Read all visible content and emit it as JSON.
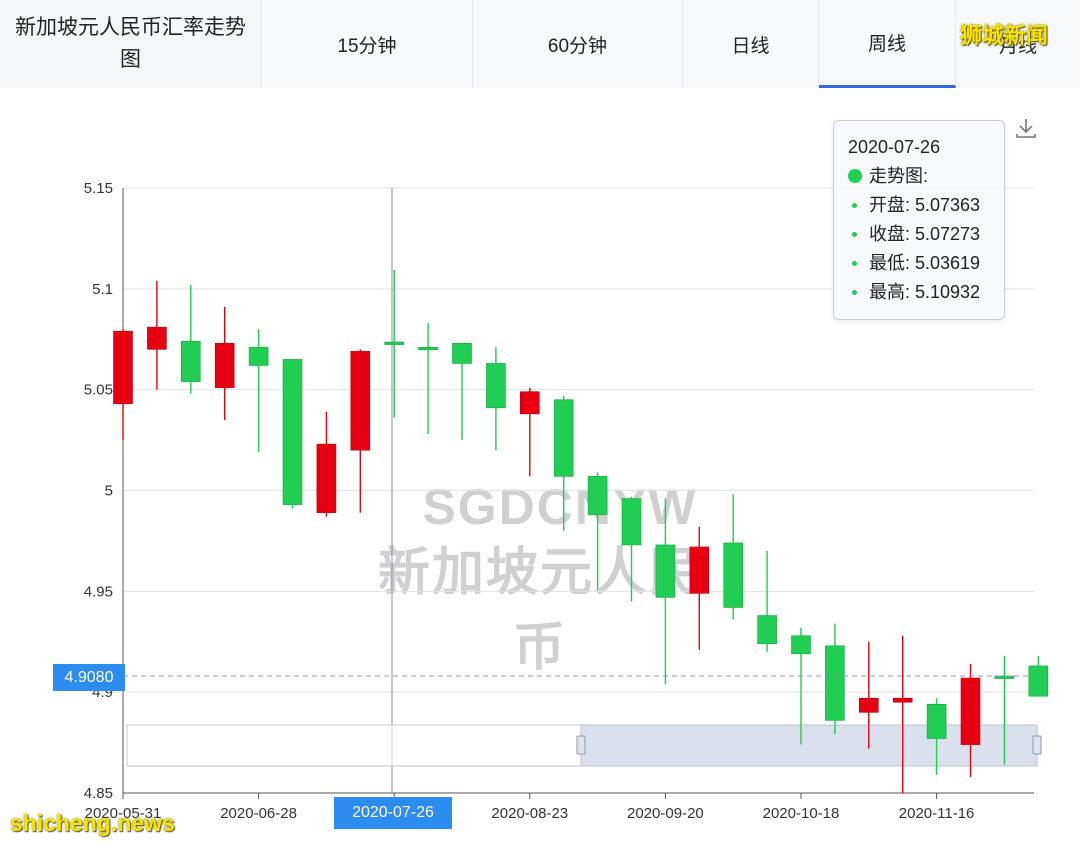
{
  "tabs": {
    "title": "新加坡元人民币汇率走势图",
    "items": [
      {
        "label": "15分钟",
        "active": false
      },
      {
        "label": "60分钟",
        "active": false
      },
      {
        "label": "日线",
        "active": false
      },
      {
        "label": "周线",
        "active": true
      },
      {
        "label": "月线",
        "active": false
      }
    ]
  },
  "tooltip": {
    "date": "2020-07-26",
    "series": "走势图:",
    "open": "开盘: 5.07363",
    "close": "收盘: 5.07273",
    "low": "最低: 5.03619",
    "high": "最高: 5.10932"
  },
  "crosshair": {
    "price_label": "4.9080",
    "date_label": "2020-07-26"
  },
  "watermark": {
    "line1": "SGDCNYW",
    "line2": "新加坡元人民币"
  },
  "logos": {
    "top": "狮城新闻",
    "bottom": "shicheng.news"
  },
  "icons": {
    "download": "download-icon"
  },
  "colors": {
    "up": "#e60012",
    "down": "#1fce52",
    "accent": "#2d8cf0",
    "grid": "#e0e3e8"
  },
  "chart_data": {
    "type": "candlestick",
    "ylim": [
      4.85,
      5.15
    ],
    "yticks": [
      "4.85",
      "4.9",
      "4.95",
      "5",
      "5.05",
      "5.1",
      "5.15"
    ],
    "xtick_labels": [
      {
        "index": 0,
        "label": "2020-05-31"
      },
      {
        "index": 4,
        "label": "2020-06-28"
      },
      {
        "index": 8,
        "label": "2020-07-26"
      },
      {
        "index": 12,
        "label": "2020-08-23"
      },
      {
        "index": 16,
        "label": "2020-09-20"
      },
      {
        "index": 20,
        "label": "2020-10-18"
      },
      {
        "index": 24,
        "label": "2020-11-16"
      }
    ],
    "candles": [
      {
        "open": 5.043,
        "close": 5.079,
        "high": 5.08,
        "low": 5.025,
        "dir": "up"
      },
      {
        "open": 5.07,
        "close": 5.081,
        "high": 5.104,
        "low": 5.05,
        "dir": "up"
      },
      {
        "open": 5.074,
        "close": 5.054,
        "high": 5.102,
        "low": 5.048,
        "dir": "down"
      },
      {
        "open": 5.051,
        "close": 5.073,
        "high": 5.091,
        "low": 5.035,
        "dir": "up"
      },
      {
        "open": 5.071,
        "close": 5.062,
        "high": 5.08,
        "low": 5.019,
        "dir": "down"
      },
      {
        "open": 5.065,
        "close": 4.993,
        "high": 5.065,
        "low": 4.991,
        "dir": "down"
      },
      {
        "open": 4.989,
        "close": 5.023,
        "high": 5.039,
        "low": 4.987,
        "dir": "up"
      },
      {
        "open": 5.02,
        "close": 5.069,
        "high": 5.07,
        "low": 4.989,
        "dir": "up"
      },
      {
        "open": 5.07363,
        "close": 5.07273,
        "high": 5.10932,
        "low": 5.03619,
        "dir": "down"
      },
      {
        "open": 5.071,
        "close": 5.07,
        "high": 5.083,
        "low": 5.028,
        "dir": "down"
      },
      {
        "open": 5.073,
        "close": 5.063,
        "high": 5.073,
        "low": 5.025,
        "dir": "down"
      },
      {
        "open": 5.063,
        "close": 5.041,
        "high": 5.071,
        "low": 5.02,
        "dir": "down"
      },
      {
        "open": 5.038,
        "close": 5.049,
        "high": 5.051,
        "low": 5.007,
        "dir": "up"
      },
      {
        "open": 5.045,
        "close": 5.007,
        "high": 5.047,
        "low": 4.98,
        "dir": "down"
      },
      {
        "open": 5.007,
        "close": 4.988,
        "high": 5.009,
        "low": 4.951,
        "dir": "down"
      },
      {
        "open": 4.996,
        "close": 4.973,
        "high": 4.997,
        "low": 4.945,
        "dir": "down"
      },
      {
        "open": 4.973,
        "close": 4.947,
        "high": 4.996,
        "low": 4.904,
        "dir": "down"
      },
      {
        "open": 4.949,
        "close": 4.972,
        "high": 4.982,
        "low": 4.921,
        "dir": "up"
      },
      {
        "open": 4.974,
        "close": 4.942,
        "high": 4.998,
        "low": 4.936,
        "dir": "down"
      },
      {
        "open": 4.938,
        "close": 4.924,
        "high": 4.97,
        "low": 4.92,
        "dir": "down"
      },
      {
        "open": 4.928,
        "close": 4.919,
        "high": 4.932,
        "low": 4.874,
        "dir": "down"
      },
      {
        "open": 4.923,
        "close": 4.886,
        "high": 4.934,
        "low": 4.879,
        "dir": "down"
      },
      {
        "open": 4.89,
        "close": 4.897,
        "high": 4.925,
        "low": 4.872,
        "dir": "up"
      },
      {
        "open": 4.895,
        "close": 4.897,
        "high": 4.928,
        "low": 4.85,
        "dir": "up"
      },
      {
        "open": 4.894,
        "close": 4.877,
        "high": 4.897,
        "low": 4.859,
        "dir": "down"
      },
      {
        "open": 4.874,
        "close": 4.907,
        "high": 4.914,
        "low": 4.858,
        "dir": "up"
      },
      {
        "open": 4.908,
        "close": 4.908,
        "high": 4.918,
        "low": 4.864,
        "dir": "down"
      },
      {
        "open": 4.913,
        "close": 4.898,
        "high": 4.918,
        "low": 4.898,
        "dir": "down"
      }
    ],
    "reference_line": 4.908,
    "crosshair_index": 8,
    "zoom_window": [
      0.5,
      1.0
    ]
  }
}
